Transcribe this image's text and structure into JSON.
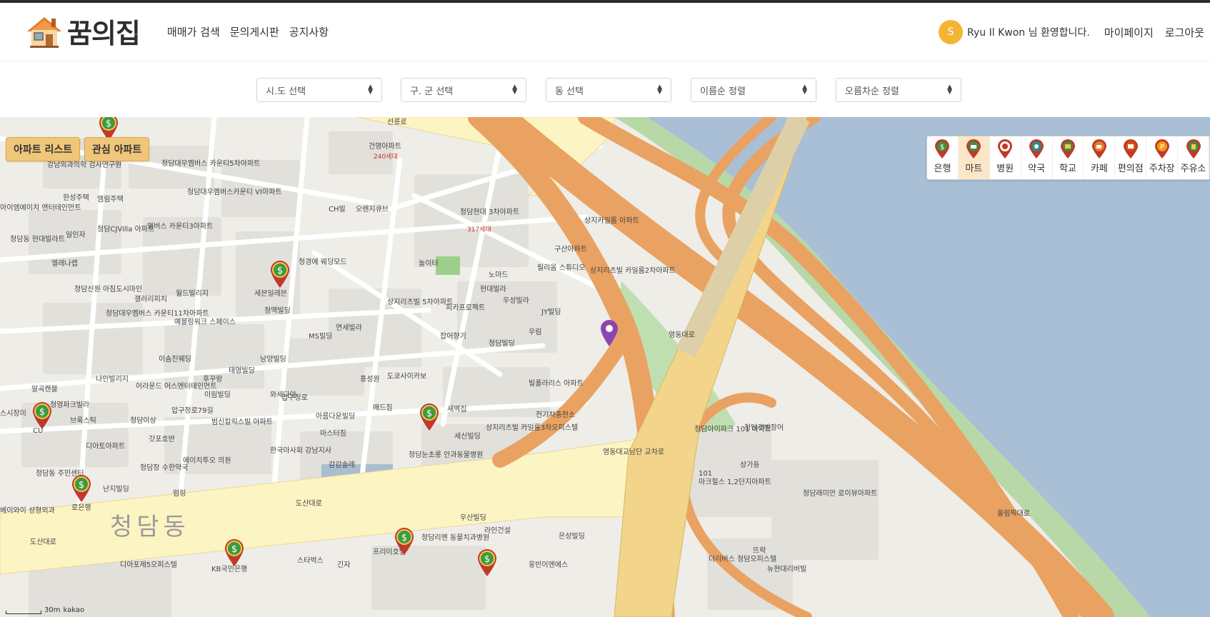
{
  "header": {
    "logo_text": "꿈의집",
    "nav": [
      "매매가 검색",
      "문의게시판",
      "공지사항"
    ],
    "user_initial": "S",
    "welcome": "Ryu Il Kwon 님 환영합니다.",
    "mypage": "마이페이지",
    "logout": "로그아웃"
  },
  "filters": [
    {
      "label": "시.도 선택"
    },
    {
      "label": "구. 군 선택"
    },
    {
      "label": "동 선택"
    },
    {
      "label": "이름순 정렬"
    },
    {
      "label": "오름차순 정렬"
    }
  ],
  "map": {
    "apt_list_button": "아파트 리스트",
    "fav_apt_button": "관심 아파트",
    "categories": [
      {
        "label": "은행",
        "icon": "bank-icon",
        "color": "#3e8e41"
      },
      {
        "label": "마트",
        "icon": "mart-icon",
        "color": "#3e8e41"
      },
      {
        "label": "병원",
        "icon": "hospital-icon",
        "color": "#c0392b"
      },
      {
        "label": "약국",
        "icon": "pharmacy-icon",
        "color": "#2e8b8b"
      },
      {
        "label": "학교",
        "icon": "school-icon",
        "color": "#3e8e41"
      },
      {
        "label": "카페",
        "icon": "cafe-icon",
        "color": "#d35400"
      },
      {
        "label": "편의점",
        "icon": "convenience-icon",
        "color": "#c0392b"
      },
      {
        "label": "주차장",
        "icon": "parking-icon",
        "color": "#e67e22"
      },
      {
        "label": "주유소",
        "icon": "gas-station-icon",
        "color": "#3e8e41"
      }
    ],
    "scale_text": "30m",
    "provider": "kakao",
    "district_label": "청담동",
    "labels": {
      "l1": "강남외과의학 검사연구원",
      "l2": "청담대우멤버스 카운티5차아파트",
      "l3": "한성주택",
      "l4": "엠림주택",
      "l5": "청담대우멤버스카운티 VI아파트",
      "l6": "CH빌",
      "l7": "오렌지큐브",
      "l8": "청담현대 3차아파트",
      "l9": "317세대",
      "l10": "240세대",
      "l11": "건영아파트",
      "l12": "상지카일룸 아파트",
      "l13": "구산아파트",
      "l14": "상지리츠빌 카일룸2차아파트",
      "l15": "놀이터",
      "l16": "노마드",
      "l17": "릴리움 스튜디오",
      "l18": "현대빌라",
      "l19": "우성빌라",
      "l20": "JY빌딩",
      "l21": "피카프로젝트",
      "l22": "상지리츠빌 5차아파트",
      "l23": "잡어향기",
      "l24": "청담빌딩",
      "l25": "우림",
      "l26": "연세빌라",
      "l27": "MS빌딩",
      "l28": "세븐일레븐",
      "l29": "청맥빌딩",
      "l30": "청경에 웨딩모드",
      "l31": "월드빌리지",
      "l32": "갤러리피치",
      "l33": "청담신원 아침도시마인",
      "l34": "엘레나랩",
      "l35": "청담CJVilla 아파트",
      "l36": "엠버스 카운티3아파트",
      "l37": "일인자",
      "l38": "청담동 현대빌라트",
      "l39": "청담대우멤버스 카운티11차아파트",
      "l40": "예블링워크 스페이스",
      "l41": "이솜진웨딩",
      "l42": "남양빌딩",
      "l43": "태영빌딩",
      "l44": "후꾸랑",
      "l45": "나인빌리지",
      "l46": "어라운드 어스엔터테인먼트",
      "l47": "이림빌딩",
      "l48": "와세다야",
      "l49": "도쿄사이카보",
      "l50": "홍성원",
      "l51": "알곡캔블",
      "l52": "청영파크빌라",
      "l53": "브룩스틱",
      "l54": "청담이상",
      "l55": "범신칼릭스빌 아파트",
      "l56": "아름다운빌딩",
      "l57": "매드짐",
      "l58": "새벽집",
      "l59": "빌폴라리스 아파트",
      "l60": "전기차충전소",
      "l61": "마스터짐",
      "l62": "세신빌딩",
      "l63": "상지리츠빌 카일룸3차오피스텔",
      "l64": "청담눈초롱 안과동물병원",
      "l65": "한국마사회 강남지사",
      "l66": "감감솔레",
      "l67": "디아토아파트",
      "l68": "갓포호반",
      "l69": "에이치투오 의원",
      "l70": "청담장 수한약국",
      "l71": "청담동 주민센터",
      "l72": "난지빌딩",
      "l73": "럼링",
      "l74": "CU",
      "l75": "우산빌딩",
      "l76": "라인건설",
      "l77": "청담리멘 동물치과병원",
      "l78": "프리미호텔",
      "l79": "은성빌딩",
      "l80": "스타벅스",
      "l81": "긴자",
      "l82": "KB국민은행",
      "l83": "디아포제5오피스텔",
      "l84": "웅빈이엔에스",
      "l85": "청담아이파크 101 아파트",
      "l86": "청담갯벌장어",
      "l87": "상가동",
      "l88": "마크힐스 1,2단지아파트",
      "l89": "청담래미안 로이뷰아파트",
      "l90": "뜨락",
      "l91": "더리버스 청담오피스텔",
      "l92": "영동대교남단 교차로",
      "l93": "도산대로",
      "l94": "선릉로",
      "l95": "압구정로79길",
      "l96": "압구정로",
      "l97": "올림픽대로",
      "l98": "영동대로",
      "l99": "뉴현대리버빌",
      "l100": "아이엠에이치 엔터테인먼트",
      "l101": "스시장미",
      "l102": "로은행",
      "l103": "베이와이 성형외과",
      "l104": "101"
    }
  }
}
